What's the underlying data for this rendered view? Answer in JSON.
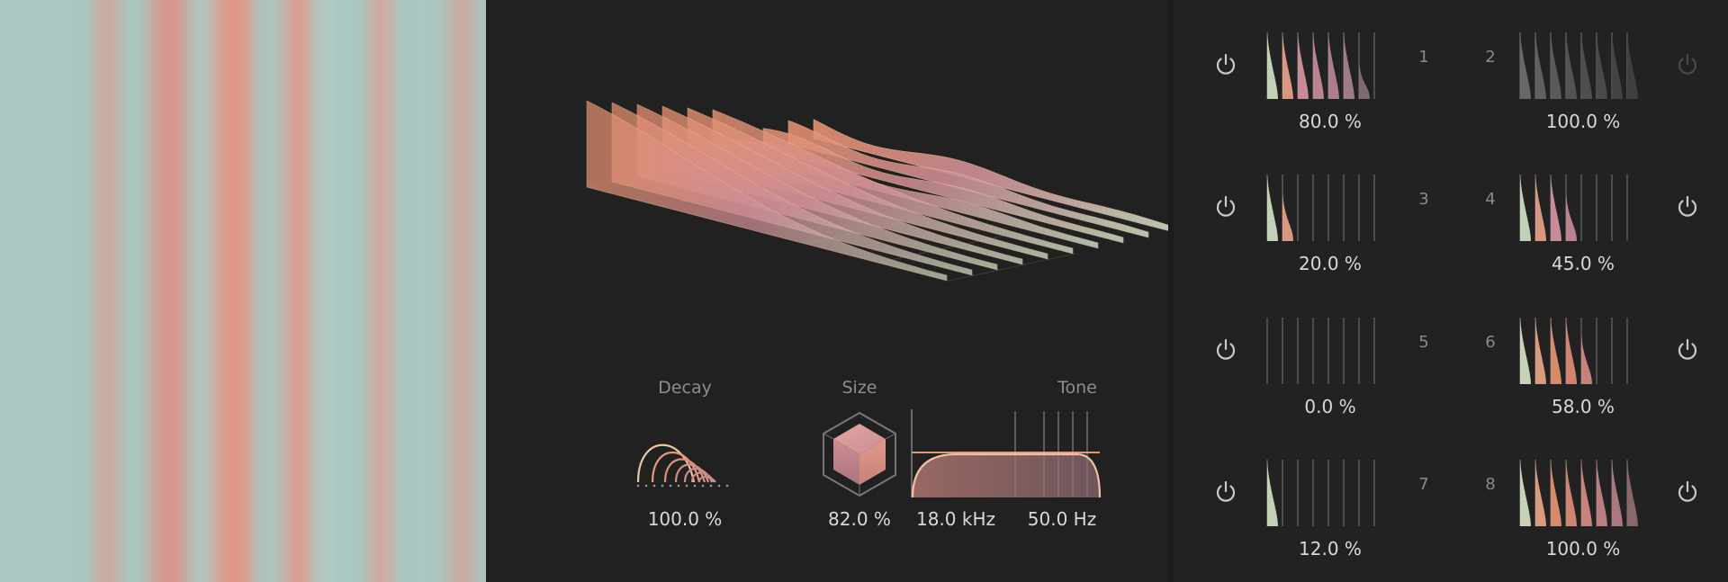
{
  "controls": {
    "decay": {
      "label": "Decay",
      "value": "100.0 %"
    },
    "size": {
      "label": "Size",
      "value": "82.0 %"
    },
    "tone": {
      "label": "Tone",
      "high": "18.0 kHz",
      "low": "50.0 Hz"
    }
  },
  "bands": [
    {
      "number": "1",
      "value": "80.0 %",
      "enabled": true,
      "level": 0.8
    },
    {
      "number": "2",
      "value": "100.0 %",
      "enabled": false,
      "level": 1.0
    },
    {
      "number": "3",
      "value": "20.0 %",
      "enabled": true,
      "level": 0.2
    },
    {
      "number": "4",
      "value": "45.0 %",
      "enabled": true,
      "level": 0.45
    },
    {
      "number": "5",
      "value": "0.0 %",
      "enabled": true,
      "level": 0.0
    },
    {
      "number": "6",
      "value": "58.0 %",
      "enabled": true,
      "level": 0.58
    },
    {
      "number": "7",
      "value": "12.0 %",
      "enabled": true,
      "level": 0.12
    },
    {
      "number": "8",
      "value": "100.0 %",
      "enabled": true,
      "level": 1.0
    }
  ],
  "colors": {
    "accent": "#e8946f",
    "mint": "#bcd9c4",
    "pink": "#c98a9a",
    "background": "#212121"
  }
}
